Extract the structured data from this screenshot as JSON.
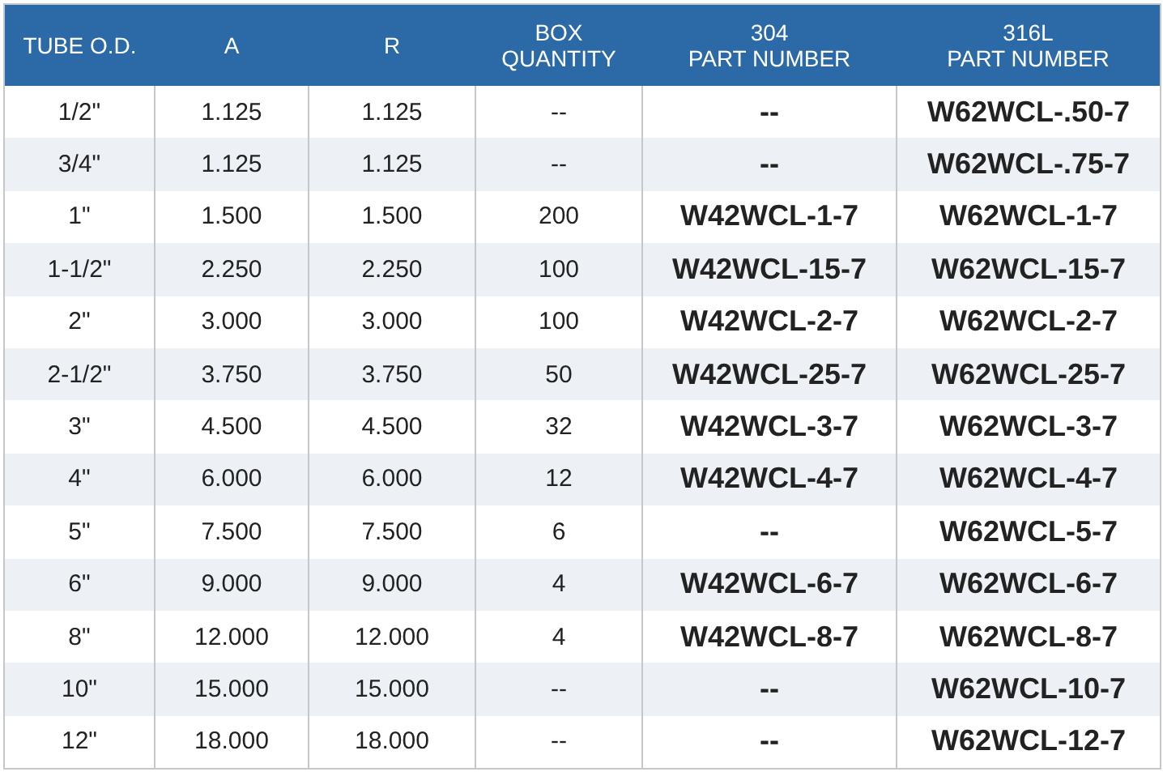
{
  "table": {
    "columns": [
      "TUBE O.D.",
      "A",
      "R",
      "BOX\nQUANTITY",
      "304\nPART NUMBER",
      "316L\nPART NUMBER"
    ],
    "rows": [
      [
        "1/2\"",
        "1.125",
        "1.125",
        "--",
        "--",
        "W62WCL-.50-7"
      ],
      [
        "3/4\"",
        "1.125",
        "1.125",
        "--",
        "--",
        "W62WCL-.75-7"
      ],
      [
        "1\"",
        "1.500",
        "1.500",
        "200",
        "W42WCL-1-7",
        "W62WCL-1-7"
      ],
      [
        "1-1/2\"",
        "2.250",
        "2.250",
        "100",
        "W42WCL-15-7",
        "W62WCL-15-7"
      ],
      [
        "2\"",
        "3.000",
        "3.000",
        "100",
        "W42WCL-2-7",
        "W62WCL-2-7"
      ],
      [
        "2-1/2\"",
        "3.750",
        "3.750",
        "50",
        "W42WCL-25-7",
        "W62WCL-25-7"
      ],
      [
        "3\"",
        "4.500",
        "4.500",
        "32",
        "W42WCL-3-7",
        "W62WCL-3-7"
      ],
      [
        "4\"",
        "6.000",
        "6.000",
        "12",
        "W42WCL-4-7",
        "W62WCL-4-7"
      ],
      [
        "5\"",
        "7.500",
        "7.500",
        "6",
        "--",
        "W62WCL-5-7"
      ],
      [
        "6\"",
        "9.000",
        "9.000",
        "4",
        "W42WCL-6-7",
        "W62WCL-6-7"
      ],
      [
        "8\"",
        "12.000",
        "12.000",
        "4",
        "W42WCL-8-7",
        "W62WCL-8-7"
      ],
      [
        "10\"",
        "15.000",
        "15.000",
        "--",
        "--",
        "W62WCL-10-7"
      ],
      [
        "12\"",
        "18.000",
        "18.000",
        "--",
        "--",
        "W62WCL-12-7"
      ]
    ]
  }
}
